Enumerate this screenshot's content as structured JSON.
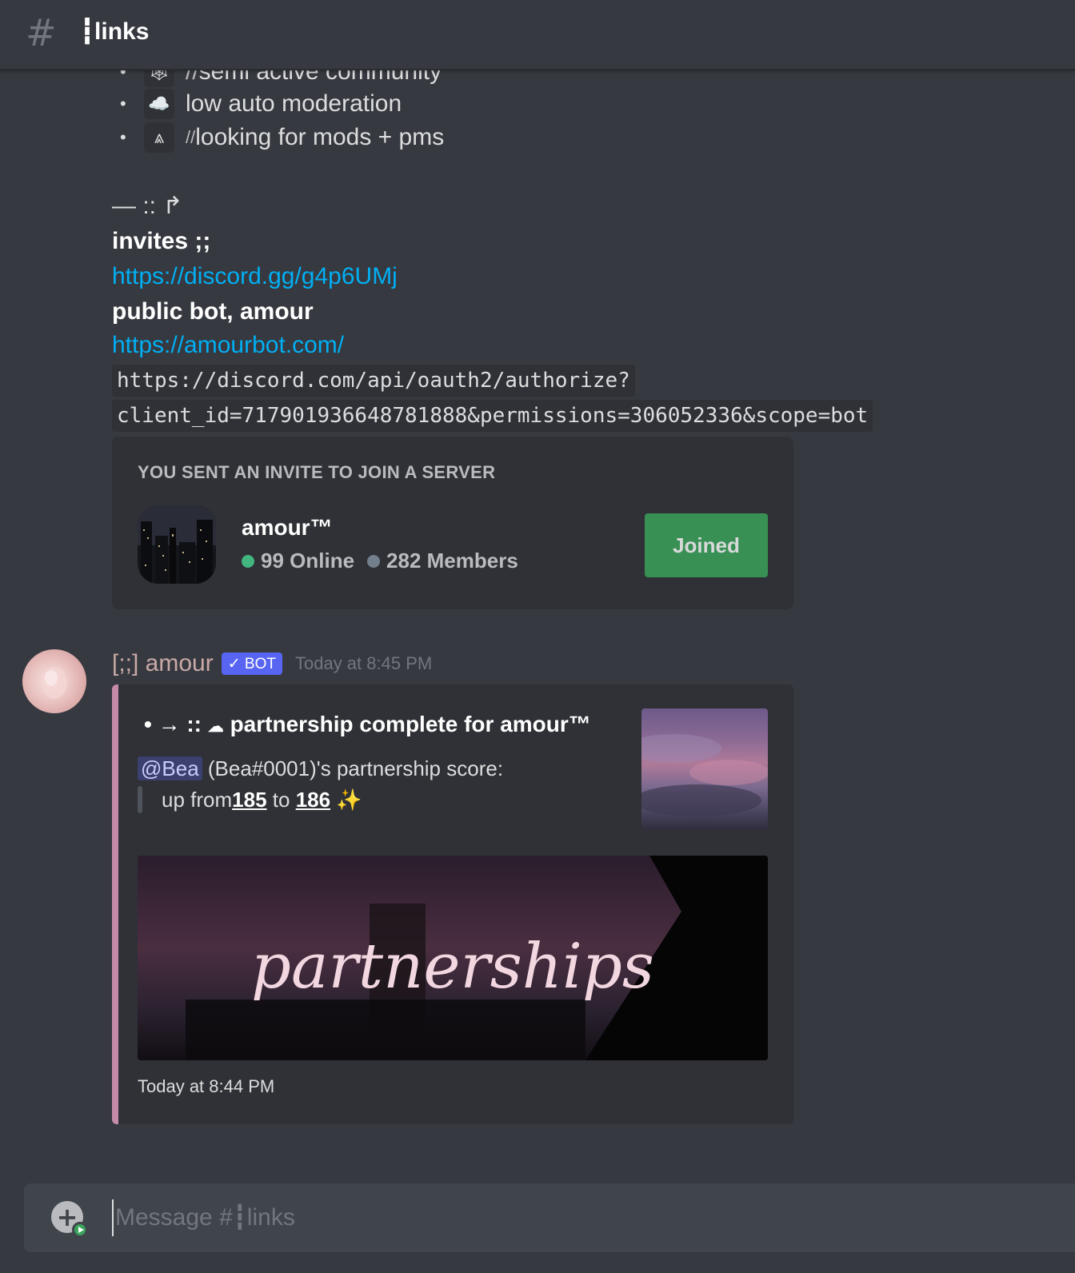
{
  "header": {
    "channel_name": "┇links"
  },
  "message_partial": {
    "bullets": [
      {
        "emoji": "🕸",
        "prefix": "// ",
        "text": "semi active community"
      },
      {
        "emoji": "☁️",
        "prefix": "",
        "text": "low auto moderation"
      },
      {
        "emoji": "⩓",
        "prefix": "// ",
        "text": "looking for mods + pms"
      }
    ],
    "bullet_glyph": "•",
    "separator": "— :: ↱",
    "invites_heading": "invites ;;",
    "invite_link": "https://discord.gg/g4p6UMj",
    "bot_heading": "public bot, amour",
    "bot_link": "https://amourbot.com/",
    "oauth_line1": "https://discord.com/api/oauth2/authorize?",
    "oauth_line2": "client_id=717901936648781888&permissions=306052336&scope=bot"
  },
  "invite_card": {
    "title": "YOU SENT AN INVITE TO JOIN A SERVER",
    "server_name": "amour™",
    "online": "99 Online",
    "members": "282 Members",
    "button_label": "Joined"
  },
  "bot_message": {
    "username": "[;;] amour",
    "bot_tag": "✓ BOT",
    "timestamp": "Today at 8:45 PM",
    "embed": {
      "title_prefix": "• → :: ",
      "title": "partnership complete for amour™",
      "mention": "@Bea",
      "desc_rest": " (Bea#0001)'s partnership score:",
      "up_from": "up from ",
      "score_from": "185",
      "to": " to ",
      "score_to": "186",
      "sparkle": " ✨",
      "image_text": "partnerships",
      "footer": "Today at 8:44 PM"
    }
  },
  "input": {
    "placeholder": "Message #┇links"
  },
  "colors": {
    "background": "#36393f",
    "embed_accent": "#c58aa8",
    "link": "#00aff4",
    "online": "#43b581",
    "joined": "#3ba55c",
    "blurple": "#5865f2"
  }
}
